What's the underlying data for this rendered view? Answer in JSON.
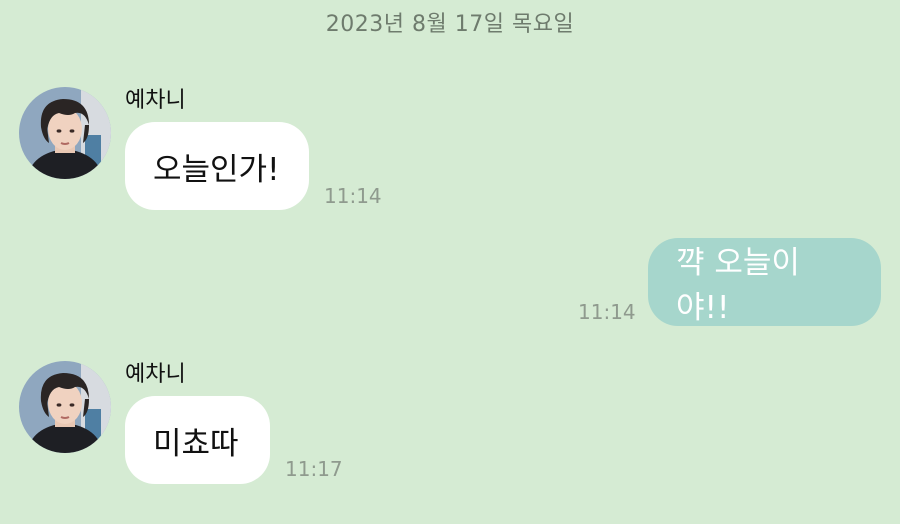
{
  "chat": {
    "date_divider": "2023년 8월 17일 목요일",
    "messages": [
      {
        "sender": "예차니",
        "text": "오늘인가!",
        "time": "11:14"
      },
      {
        "sender": "",
        "text": "꺅 오늘이야!!",
        "time": "11:14"
      },
      {
        "sender": "예차니",
        "text": "미쵸따",
        "time": "11:17"
      }
    ]
  },
  "icons": {
    "avatar": "profile-photo"
  },
  "colors": {
    "background": "#d5ebd3",
    "incoming_bubble": "#ffffff",
    "outgoing_bubble": "#a6d6cc",
    "timestamp": "#8f9a8e"
  }
}
